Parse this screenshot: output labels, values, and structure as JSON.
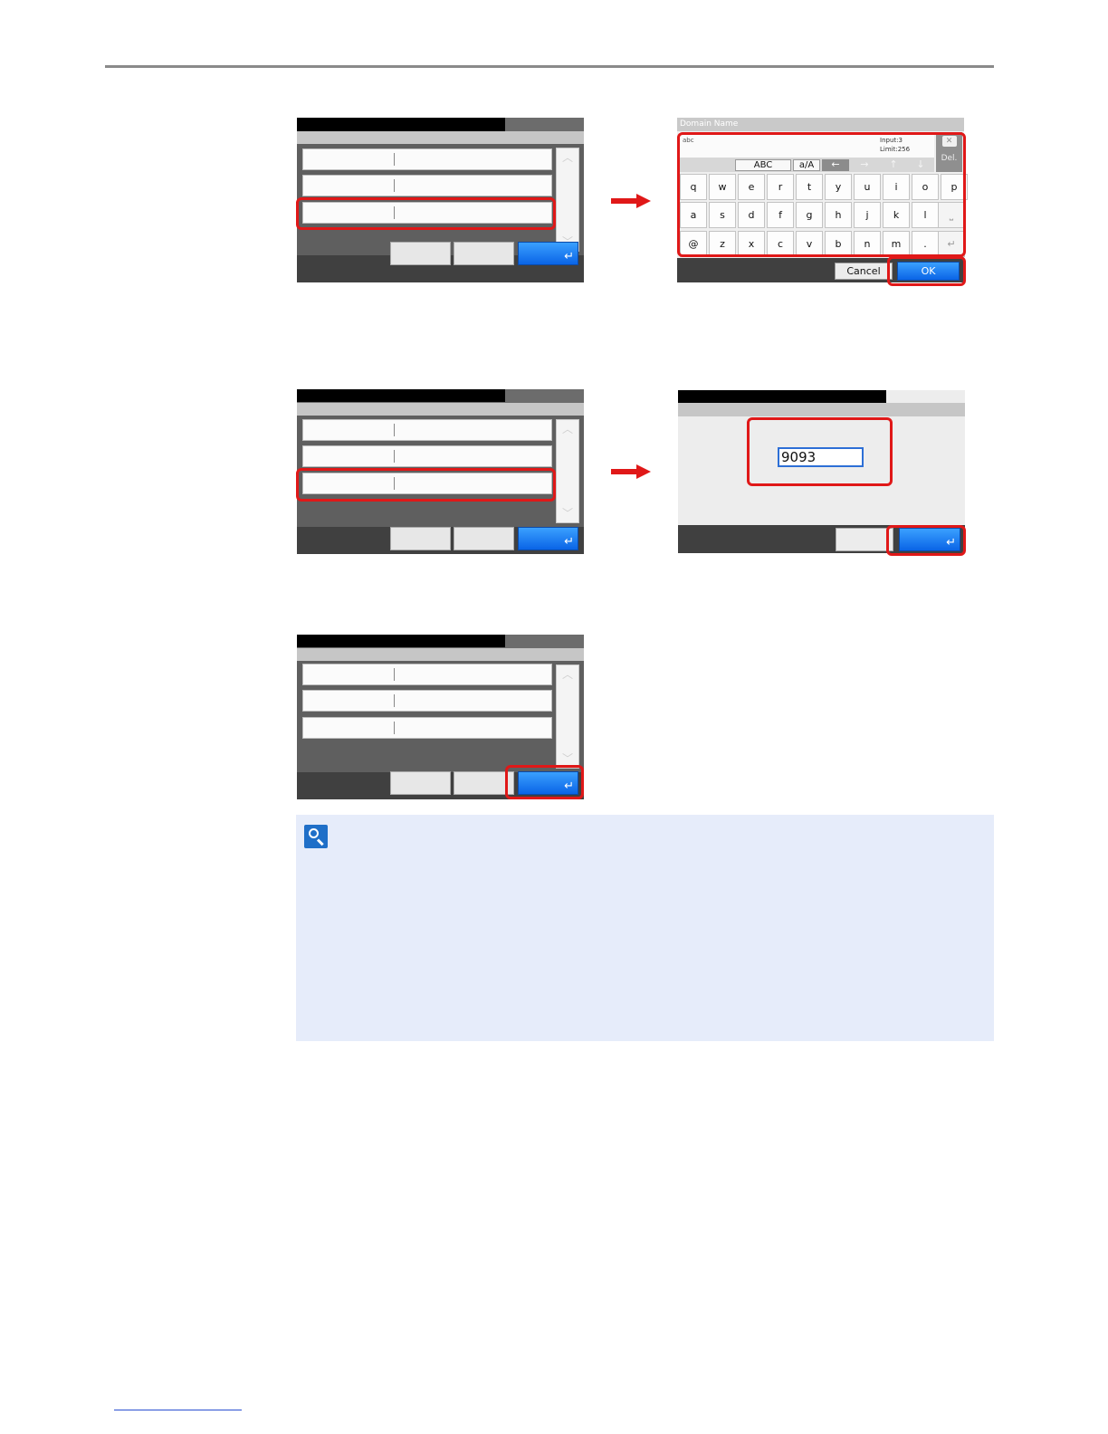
{
  "keyboard_screen": {
    "title": "Domain Name",
    "typed_text": "abc",
    "input_count": "Input:3",
    "limit": "Limit:256",
    "mode_abc": "ABC",
    "mode_case": "a/A",
    "del_label": "Del.",
    "arrow_left": "←",
    "arrow_right": "→",
    "arrow_up": "↑",
    "arrow_down": "↓",
    "row1": [
      "q",
      "w",
      "e",
      "r",
      "t",
      "y",
      "u",
      "i",
      "o",
      "p"
    ],
    "row2": [
      "a",
      "s",
      "d",
      "f",
      "g",
      "h",
      "j",
      "k",
      "l"
    ],
    "row3": [
      "@",
      "z",
      "x",
      "c",
      "v",
      "b",
      "n",
      "m",
      "."
    ],
    "cancel_label": "Cancel",
    "ok_label": "OK"
  },
  "number_screen": {
    "value": "9093"
  },
  "glyphs": {
    "enter": "↵",
    "scroll_up": "︿",
    "scroll_down": "﹀"
  },
  "colors": {
    "highlight": "#e01818",
    "ok_button": "#0a64e6",
    "note_background": "#e6ecfa"
  }
}
